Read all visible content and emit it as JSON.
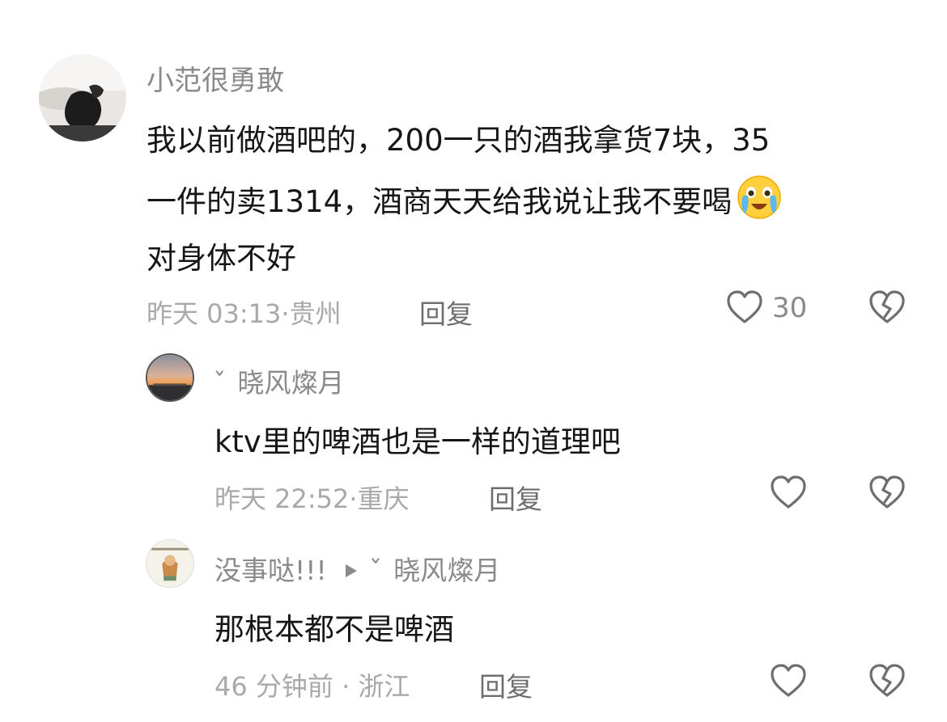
{
  "comments": [
    {
      "author": "小范很勇敢",
      "lines": [
        "我以前做酒吧的，200一只的酒我拿货7块，35",
        "一件的卖1314，酒商天天给我说让我不要喝",
        "对身体不好"
      ],
      "time": "昨天 03:13·贵州",
      "reply_label": "回复",
      "like_count": "30"
    }
  ],
  "replies": [
    {
      "author": "晓风燦月",
      "author_prefix": "ˇ",
      "text": "ktv里的啤酒也是一样的道理吧",
      "time": "昨天 22:52·重庆",
      "reply_label": "回复"
    },
    {
      "author": "没事哒!!!",
      "reply_to_prefix": "ˇ",
      "reply_to": "晓风燦月",
      "text": "那根本都不是啤酒",
      "time": "46 分钟前 · 浙江",
      "reply_label": "回复"
    }
  ],
  "colors": {
    "text": "#161616",
    "name": "#8a8a8a",
    "meta": "#a9a9a9",
    "icon": "#6e6e6e"
  },
  "icons": [
    "heart-icon",
    "broken-heart-icon",
    "crying-emoji-icon",
    "play-arrow-icon"
  ]
}
